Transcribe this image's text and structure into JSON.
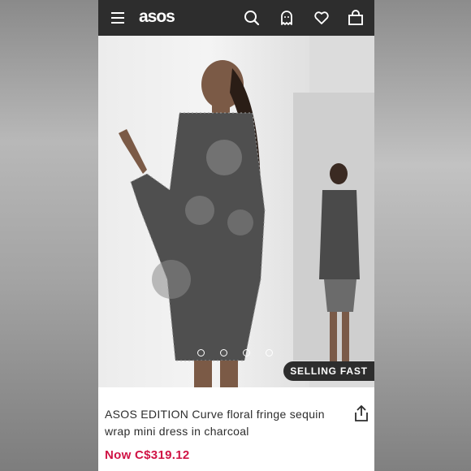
{
  "header": {
    "logo": "asos",
    "icons": [
      "menu-icon",
      "search-icon",
      "account-icon",
      "heart-icon",
      "bag-icon"
    ]
  },
  "gallery": {
    "image_count": 4,
    "active_index": 1,
    "badge": "SELLING FAST"
  },
  "product": {
    "title": "ASOS EDITION Curve floral fringe sequin wrap mini dress in charcoal",
    "price": "Now C$319.12"
  },
  "colors": {
    "header_bg": "#2d2d2d",
    "price": "#d01345",
    "text": "#2d2d2d"
  }
}
